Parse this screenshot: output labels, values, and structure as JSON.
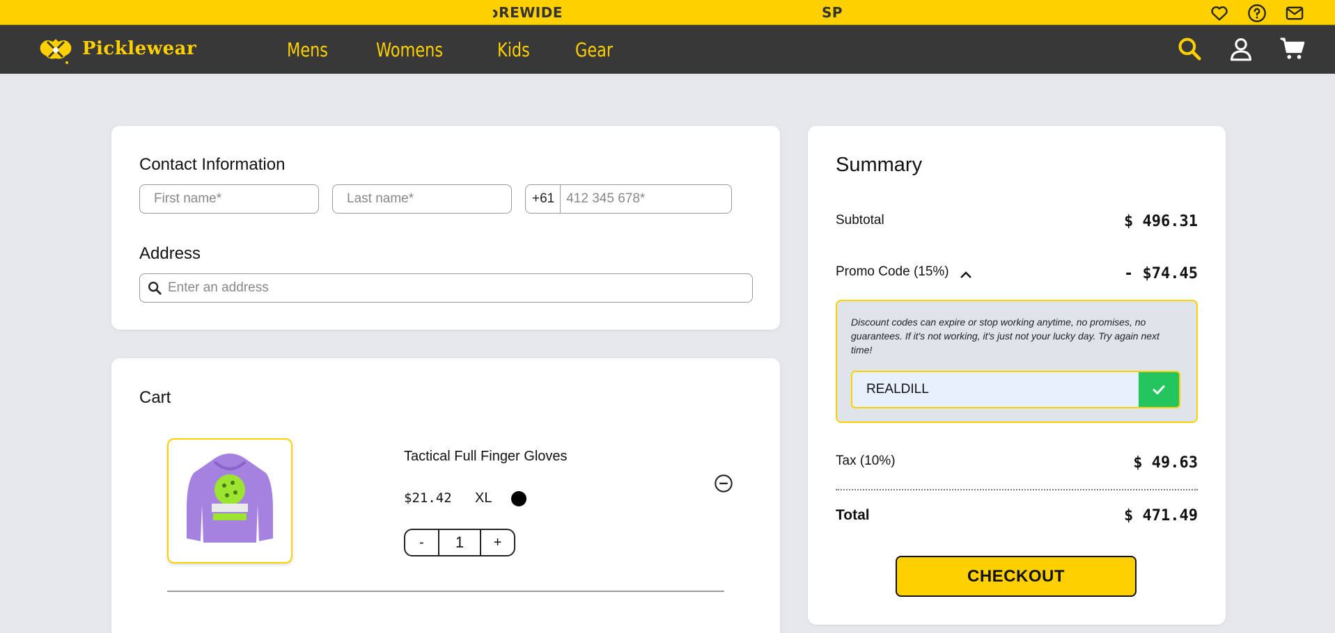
{
  "announcement": {
    "marquee_left": "ɔREWIDE!",
    "marquee_right": "SP"
  },
  "top_icons": [
    "heart-icon",
    "help-icon",
    "mail-icon"
  ],
  "brand": {
    "name": "Picklewear",
    "accent_color": "#ffd000",
    "nav_bg": "#383838"
  },
  "nav": {
    "links": [
      "Mens",
      "Womens",
      "Kids",
      "Gear"
    ],
    "icons": [
      "search-icon",
      "user-icon",
      "cart-icon"
    ]
  },
  "contact": {
    "title": "Contact Information",
    "first_name_placeholder": "First name*",
    "last_name_placeholder": "Last name*",
    "phone_prefix": "+61",
    "phone_placeholder": "412 345 678*"
  },
  "address": {
    "title": "Address",
    "placeholder": "Enter an address"
  },
  "cart": {
    "title": "Cart",
    "items": [
      {
        "name": "Tactical Full Finger Gloves",
        "price": "$21.42",
        "size": "XL",
        "color": "#000000",
        "quantity": "1",
        "decrement_label": "-",
        "increment_label": "+"
      }
    ]
  },
  "summary": {
    "title": "Summary",
    "subtotal_label": "Subtotal",
    "subtotal_value": "$ 496.31",
    "promo_label": "Promo Code (15%)",
    "promo_value": "- $74.45",
    "promo_note": "Discount codes can expire or stop working anytime, no promises, no guarantees. If it's not working, it's just not your lucky day. Try again next time!",
    "promo_code": "REALDILL",
    "tax_label": "Tax (10%)",
    "tax_value": "$ 49.63",
    "total_label": "Total",
    "total_value": "$ 471.49",
    "checkout_label": "CHECKOUT",
    "apply_color": "#22c55e"
  }
}
